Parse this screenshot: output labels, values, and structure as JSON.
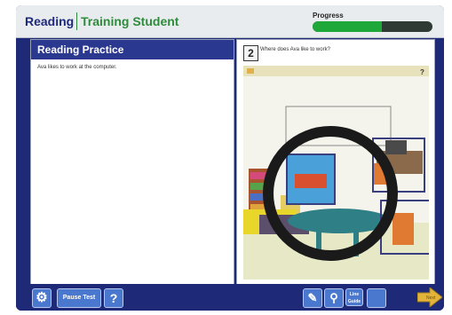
{
  "header": {
    "subject": "Reading",
    "student": "Training Student",
    "progress_label": "Progress",
    "progress_value": 0.58
  },
  "left_panel": {
    "title": "Reading Practice",
    "passage": "Ava likes to work at the computer."
  },
  "question": {
    "number": "2",
    "text": "Where does Ava like to work?"
  },
  "toolbar": {
    "settings_icon": "gear-icon",
    "pause_label": "Pause Test",
    "help_label": "?",
    "line_guide_label_1": "Line",
    "line_guide_label_2": "Guide",
    "next_label": "Next"
  }
}
